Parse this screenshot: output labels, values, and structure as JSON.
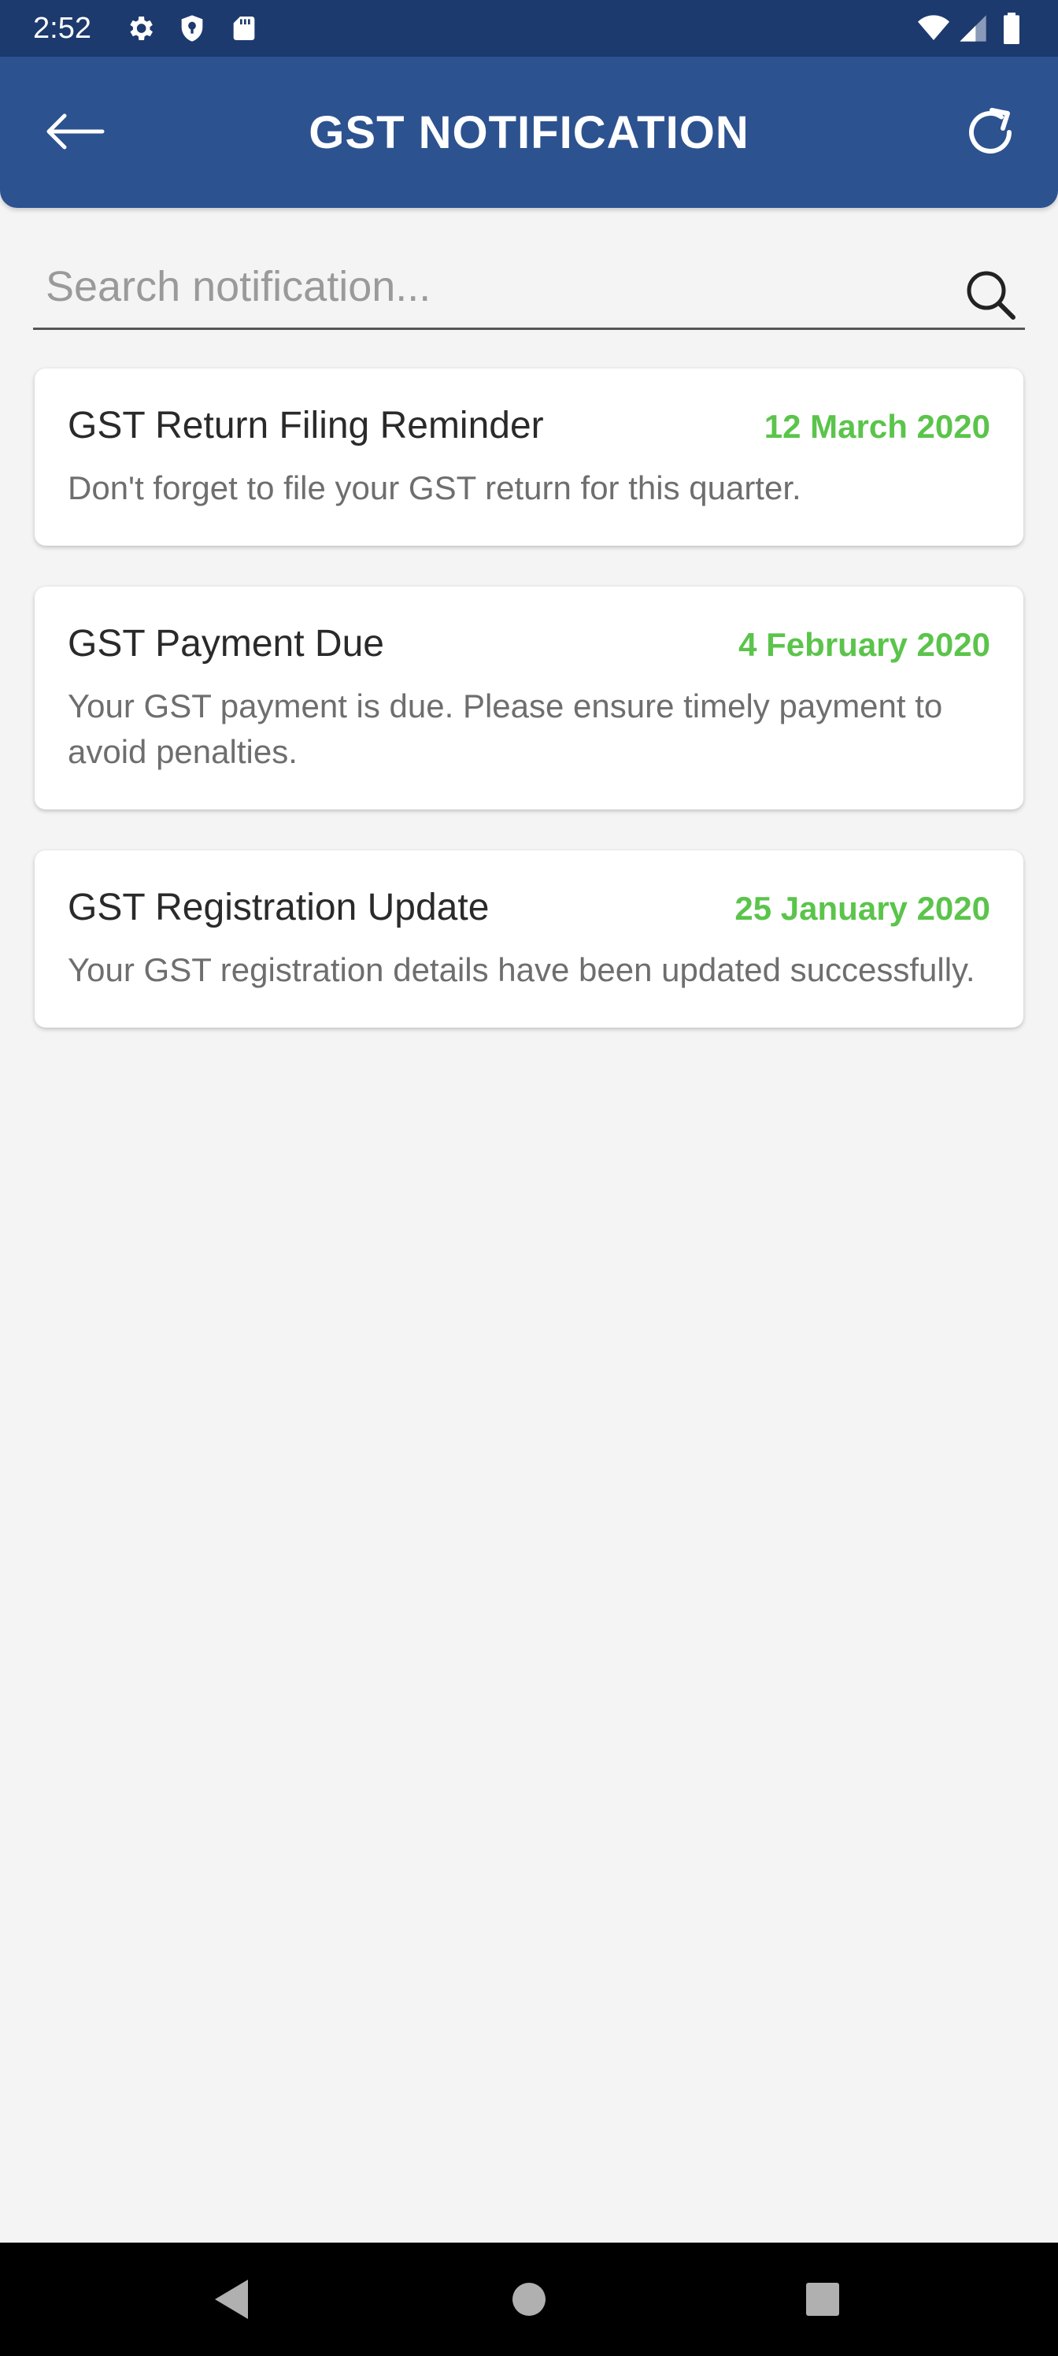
{
  "status_bar": {
    "time": "2:52",
    "icons": [
      "gear-icon",
      "shield-icon",
      "sd-card-icon",
      "wifi-icon",
      "signal-icon",
      "battery-icon"
    ]
  },
  "app_bar": {
    "title": "GST NOTIFICATION",
    "back_icon": "arrow-left-icon",
    "refresh_icon": "refresh-icon"
  },
  "search": {
    "placeholder": "Search notification...",
    "value": ""
  },
  "notifications": [
    {
      "title": "GST Return Filing Reminder",
      "date": "12 March 2020",
      "message": "Don't forget to file your GST return for this quarter."
    },
    {
      "title": "GST Payment Due",
      "date": "4 February 2020",
      "message": "Your GST payment is due. Please ensure timely payment to avoid penalties."
    },
    {
      "title": "GST Registration Update",
      "date": "25 January 2020",
      "message": "Your GST registration details have been updated successfully."
    }
  ],
  "colors": {
    "status_bar": "#1d3a6e",
    "app_bar": "#2c5290",
    "date_green": "#5bc44b",
    "background": "#f4f4f4"
  },
  "nav_bar": {
    "icons": [
      "back-triangle-icon",
      "home-circle-icon",
      "recents-square-icon"
    ]
  }
}
